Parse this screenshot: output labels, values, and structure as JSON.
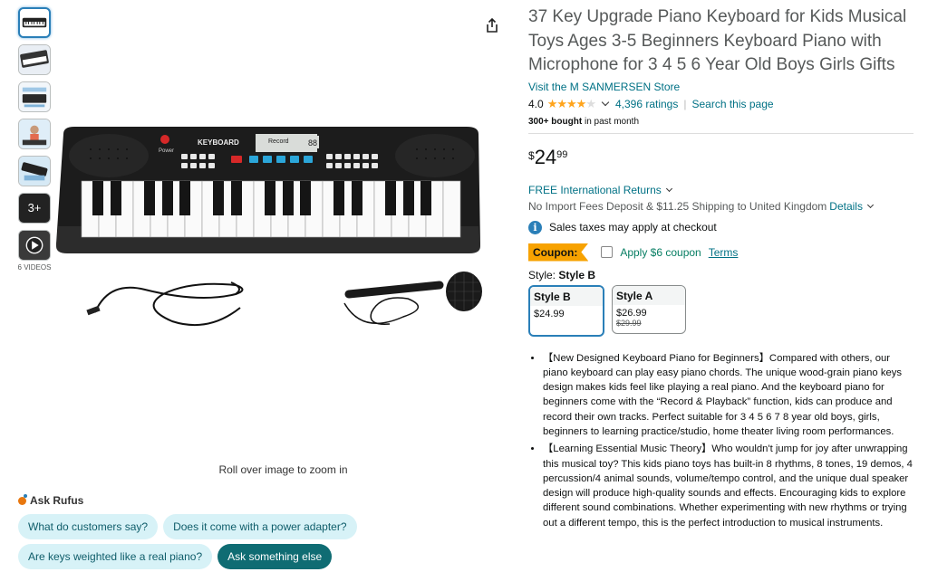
{
  "thumbnails": {
    "videos_badge": "3+",
    "videos_caption": "6 VIDEOS"
  },
  "image": {
    "keyboard_brand": "KEYBOARD",
    "keyboard_power": "Power",
    "keyboard_record": "Record",
    "keyboard_display": "88",
    "zoom_hint": "Roll over image to zoom in"
  },
  "rufus": {
    "title": "Ask Rufus",
    "questions": [
      "What do customers say?",
      "Does it come with a power adapter?",
      "Are keys weighted like a real piano?",
      "Ask something else"
    ]
  },
  "product": {
    "title": "37 Key Upgrade Piano Keyboard for Kids Musical Toys Ages 3-5 Beginners Keyboard Piano with Microphone for 3 4 5 6 Year Old Boys Girls Gifts",
    "store_link": "Visit the M SANMERSEN Store",
    "rating_value": "4.0",
    "rating_stars": 4.0,
    "ratings_count": "4,396 ratings",
    "search_page": "Search this page",
    "bought_bold": "300+ bought",
    "bought_rest": " in past month",
    "price_symbol": "$",
    "price_whole": "24",
    "price_fraction": "99",
    "returns": "FREE International Returns",
    "shipping_text": "No Import Fees Deposit & $11.25 Shipping to United Kingdom ",
    "shipping_details": "Details",
    "tax_note": "Sales taxes may apply at checkout",
    "coupon_badge": "Coupon:",
    "coupon_text": "Apply $6 coupon",
    "coupon_terms": "Terms",
    "style_label": "Style: ",
    "style_selected": "Style B",
    "styles": [
      {
        "name": "Style B",
        "price": "$24.99",
        "old_price": ""
      },
      {
        "name": "Style A",
        "price": "$26.99",
        "old_price": "$29.99"
      }
    ],
    "bullets": [
      "【New Designed Keyboard Piano for Beginners】Compared with others, our piano keyboard can play easy piano chords. The unique wood-grain piano keys design makes kids feel like playing a real piano. And the keyboard piano for beginners come with the “Record & Playback” function, kids can produce and record their own tracks. Perfect suitable for 3 4 5 6 7 8 year old boys, girls, beginners to learning practice/studio, home theater living room performances.",
      "【Learning Essential Music Theory】Who wouldn't jump for joy after unwrapping this musical toy? This kids piano toys has built-in 8 rhythms, 8 tones, 19 demos, 4 percussion/4 animal sounds, volume/tempo control, and the unique dual speaker design will produce high-quality sounds and effects. Encouraging kids to explore different sound combinations. Whether experimenting with new rhythms or trying out a different tempo, this is the perfect introduction to musical instruments."
    ]
  },
  "colors": {
    "link": "#007185",
    "star": "#ffa41c",
    "coupon_badge": "#f7a200",
    "coupon_text": "#067d62",
    "selected_border": "#2a7fb8"
  },
  "icons": [
    "share-icon",
    "info-icon",
    "chevron-down-icon",
    "rufus-icon",
    "play-icon"
  ]
}
